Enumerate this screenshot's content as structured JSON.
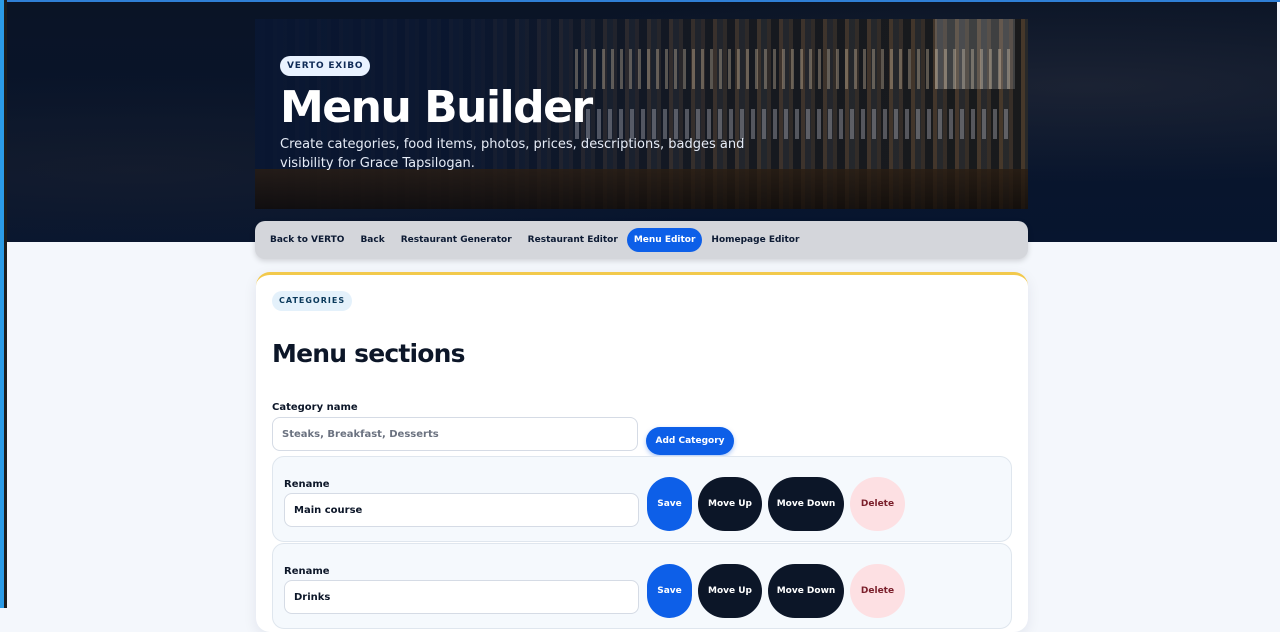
{
  "hero": {
    "brand": "VERTO EXIBO",
    "title": "Menu Builder",
    "subtitle": "Create categories, food items, photos, prices, descriptions, badges and visibility for Grace Tapsilogan."
  },
  "nav": {
    "items": [
      {
        "label": "Back to VERTO"
      },
      {
        "label": "Back"
      },
      {
        "label": "Restaurant Generator"
      },
      {
        "label": "Restaurant Editor"
      },
      {
        "label": "Menu Editor"
      },
      {
        "label": "Homepage Editor"
      }
    ],
    "active": "Menu Editor"
  },
  "categories": {
    "badge": "CATEGORIES",
    "title": "Menu sections",
    "new_label": "Category name",
    "new_placeholder": "Steaks, Breakfast, Desserts",
    "add_label": "Add Category",
    "rows": [
      {
        "rename_label": "Rename",
        "value": "Main course",
        "save": "Save",
        "up": "Move Up",
        "down": "Move Down",
        "delete": "Delete"
      },
      {
        "rename_label": "Rename",
        "value": "Drinks",
        "save": "Save",
        "up": "Move Up",
        "down": "Move Down",
        "delete": "Delete"
      }
    ]
  },
  "colors": {
    "accent": "#0d5fe8",
    "dark_button": "#0c1628",
    "danger_bg": "#fde0e3",
    "card_top_border": "#f2c94c"
  }
}
